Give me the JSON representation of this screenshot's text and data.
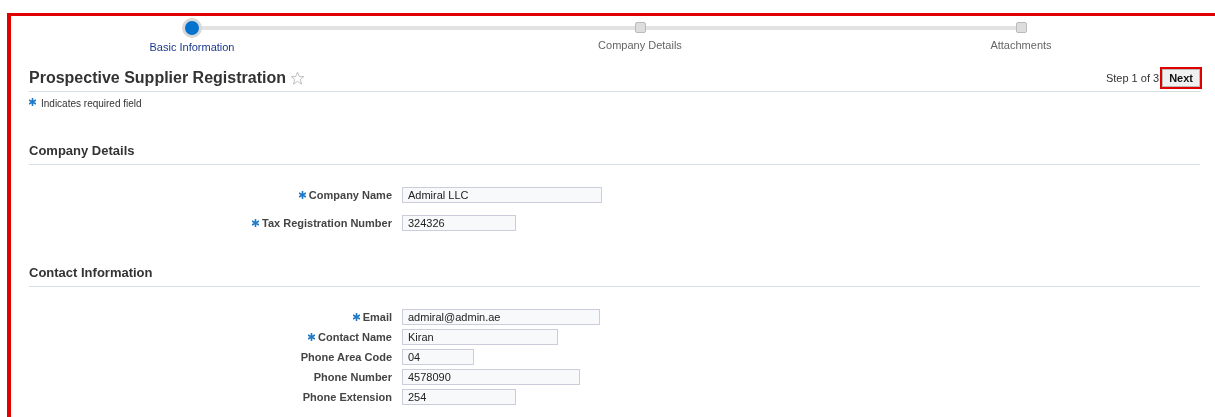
{
  "train": [
    {
      "label": "Basic Information",
      "selected": true
    },
    {
      "label": "Company Details",
      "selected": false
    },
    {
      "label": "Attachments",
      "selected": false
    }
  ],
  "page": {
    "title": "Prospective Supplier Registration",
    "favorite": false,
    "step_text": "Step 1 of 3",
    "next_button": {
      "label": "Next",
      "highlighted": true
    }
  },
  "required_note": "Indicates required field",
  "sections": [
    {
      "heading": "Company Details",
      "fields": [
        {
          "label": "Company Name",
          "required": true,
          "value": "Admiral LLC"
        },
        {
          "label": "Tax Registration Number",
          "required": true,
          "value": "324326"
        }
      ]
    },
    {
      "heading": "Contact Information",
      "fields": [
        {
          "label": "Email",
          "required": true,
          "value": "admiral@admin.ae"
        },
        {
          "label": "Contact Name",
          "required": true,
          "value": "Kiran"
        },
        {
          "label": "Phone Area Code",
          "required": false,
          "value": "04"
        },
        {
          "label": "Phone Number",
          "required": false,
          "value": "4578090"
        },
        {
          "label": "Phone Extension",
          "required": false,
          "value": "254"
        }
      ]
    }
  ]
}
